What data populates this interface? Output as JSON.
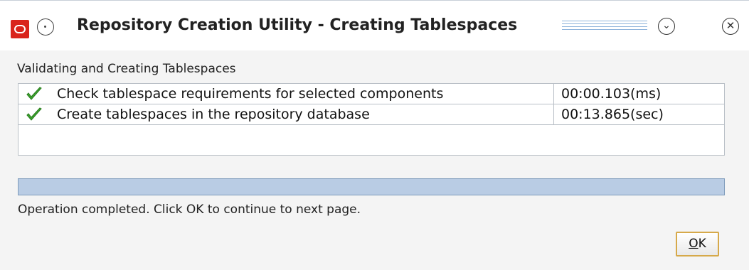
{
  "window": {
    "title": "Repository Creation Utility - Creating Tablespaces"
  },
  "section_label": "Validating and Creating Tablespaces",
  "tasks": [
    {
      "label": "Check tablespace requirements for selected components",
      "time": "00:00.103(ms)",
      "status_icon": "green-check"
    },
    {
      "label": "Create tablespaces in the repository database",
      "time": "00:13.865(sec)",
      "status_icon": "green-check"
    }
  ],
  "progress": {
    "fraction": 1.0
  },
  "status_text": "Operation completed. Click OK to continue to next page.",
  "ok_button": {
    "mnemonic": "O",
    "rest": "K"
  },
  "colors": {
    "oracle_red": "#d9241c",
    "progress_fill": "#b9cce4",
    "check_green": "#3aa12c"
  }
}
